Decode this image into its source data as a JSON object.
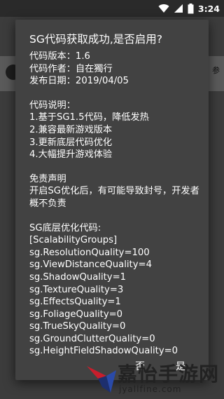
{
  "status_bar": {
    "time": "3:24",
    "icons": [
      "wifi-icon",
      "signal-icon",
      "battery-icon"
    ]
  },
  "background": {
    "snippet": "参"
  },
  "dialog": {
    "title": "SG代码获取成功,是否启用?",
    "info": {
      "version": "代码版本：1.6",
      "author": "代码作者：自在獨行",
      "date": "发布日期：2019/04/05"
    },
    "notes_title": "代码说明：",
    "notes": [
      "1.基于SG1.5代码，降低发热",
      "2.兼容最新游戏版本",
      "3.更新底层代码优化",
      "4.大幅提升游戏体验"
    ],
    "disclaimer_title": "免责声明",
    "disclaimer_text": "开启SG优化后，有可能导致封号，开发者概不负责",
    "code_title": "SG底层优化代码:",
    "code_lines": [
      "[ScalabilityGroups]",
      "sg.ResolutionQuality=100",
      "sg.ViewDistanceQuality=4",
      "sg.ShadowQuality=1",
      "sg.TextureQuality=3",
      "sg.EffectsQuality=1",
      "sg.FoliageQuality=0",
      "sg.TrueSkyQuality=0",
      "sg.GroundClutterQuality=0",
      "sg.HeightFieldShadowQuality=0"
    ],
    "buttons": {
      "no": "否",
      "yes": "是"
    }
  },
  "watermark": {
    "text": "嘉怡手游网",
    "sub": "jyallfine.com"
  },
  "colors": {
    "dialog_bg": "#424242",
    "text": "#ffffff",
    "scrim": "#3c3c3c"
  }
}
